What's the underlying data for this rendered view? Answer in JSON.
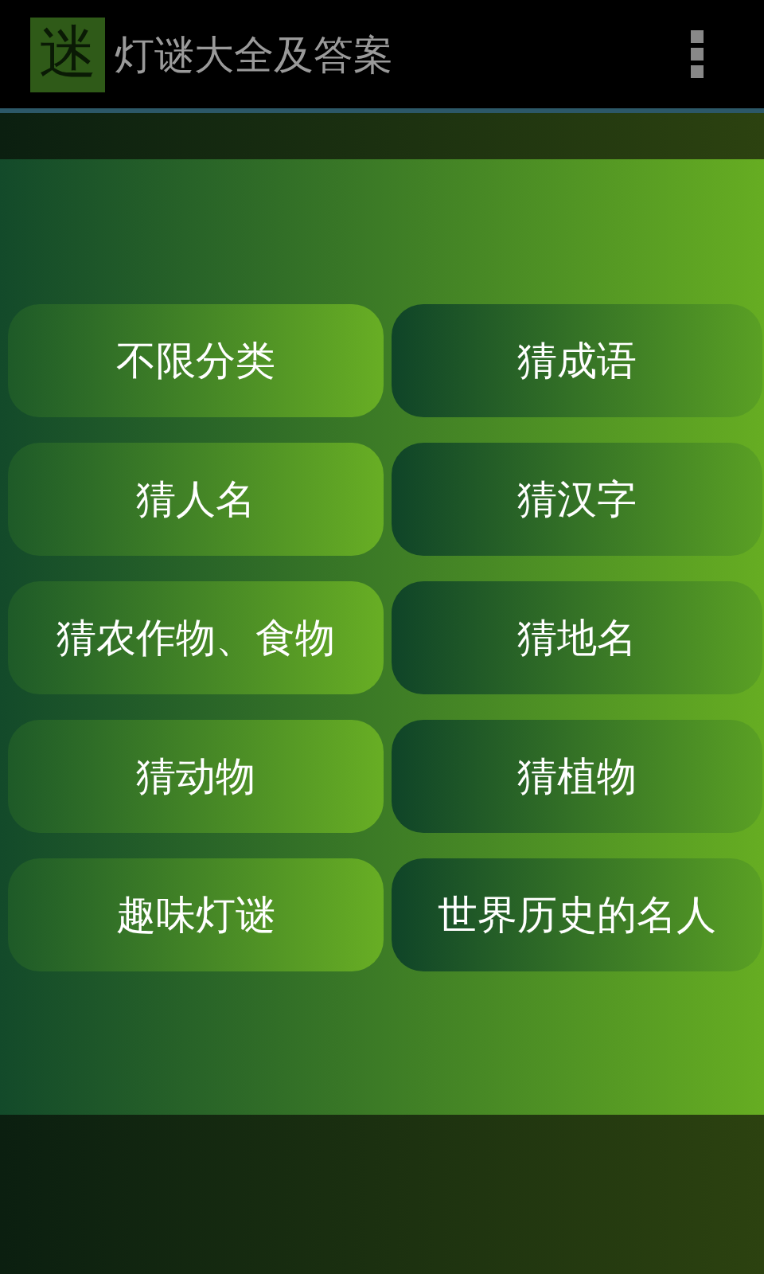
{
  "app_bar": {
    "logo_text": "迷",
    "title": "灯谜大全及答案"
  },
  "dialog": {
    "categories": [
      {
        "label": "不限分类"
      },
      {
        "label": "猜成语"
      },
      {
        "label": "猜人名"
      },
      {
        "label": "猜汉字"
      },
      {
        "label": "猜农作物、食物"
      },
      {
        "label": "猜地名"
      },
      {
        "label": "猜动物"
      },
      {
        "label": "猜植物"
      },
      {
        "label": "趣味灯谜"
      },
      {
        "label": "世界历史的名人"
      }
    ]
  }
}
